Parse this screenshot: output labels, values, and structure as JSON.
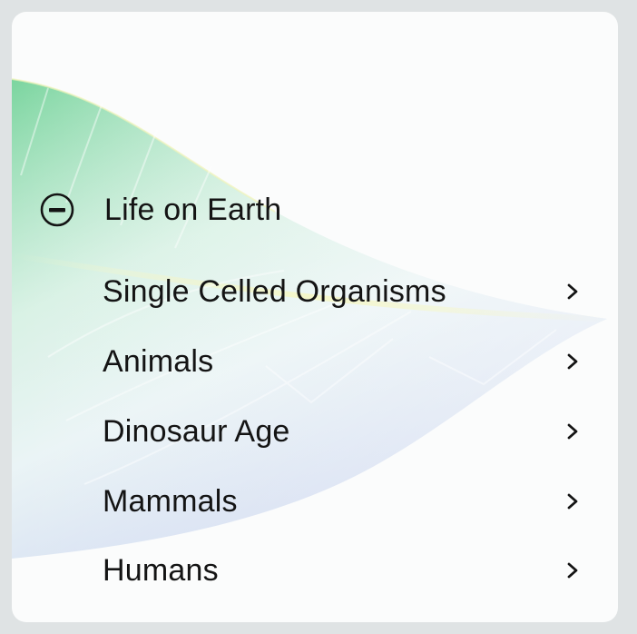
{
  "section": {
    "title": "Life on Earth",
    "collapse_icon": "minus-circle-icon"
  },
  "items": [
    {
      "label": "Single Celled Organisms",
      "icon": "chevron-right-icon"
    },
    {
      "label": "Animals",
      "icon": "chevron-right-icon"
    },
    {
      "label": "Dinosaur Age",
      "icon": "chevron-right-icon"
    },
    {
      "label": "Mammals",
      "icon": "chevron-right-icon"
    },
    {
      "label": "Humans",
      "icon": "chevron-right-icon"
    }
  ],
  "colors": {
    "background": "#dfe3e4",
    "card": "#fbfcfc",
    "text": "#141414",
    "leaf_green": "#74d39a",
    "leaf_blue": "#c9d3ef"
  }
}
